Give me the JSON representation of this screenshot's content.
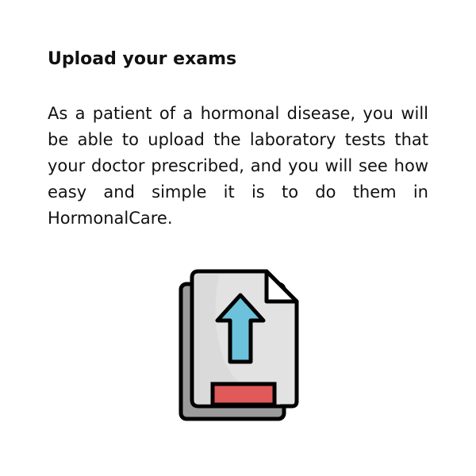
{
  "content": {
    "title": "Upload your exams",
    "description": "As a patient of a hormonal disease, you will be able to upload the laboratory tests that your doctor prescribed, and you will see how easy and simple it is to do them in HormonalCare."
  },
  "illustration": {
    "icon": "file-upload-icon",
    "colors": {
      "outline": "#000000",
      "front_sheet": "#e2e2e2",
      "back_sheet": "#9b9b9b",
      "fold": "#ffffff",
      "arrow": "#6cc2db",
      "bar": "#e15a5a"
    }
  }
}
